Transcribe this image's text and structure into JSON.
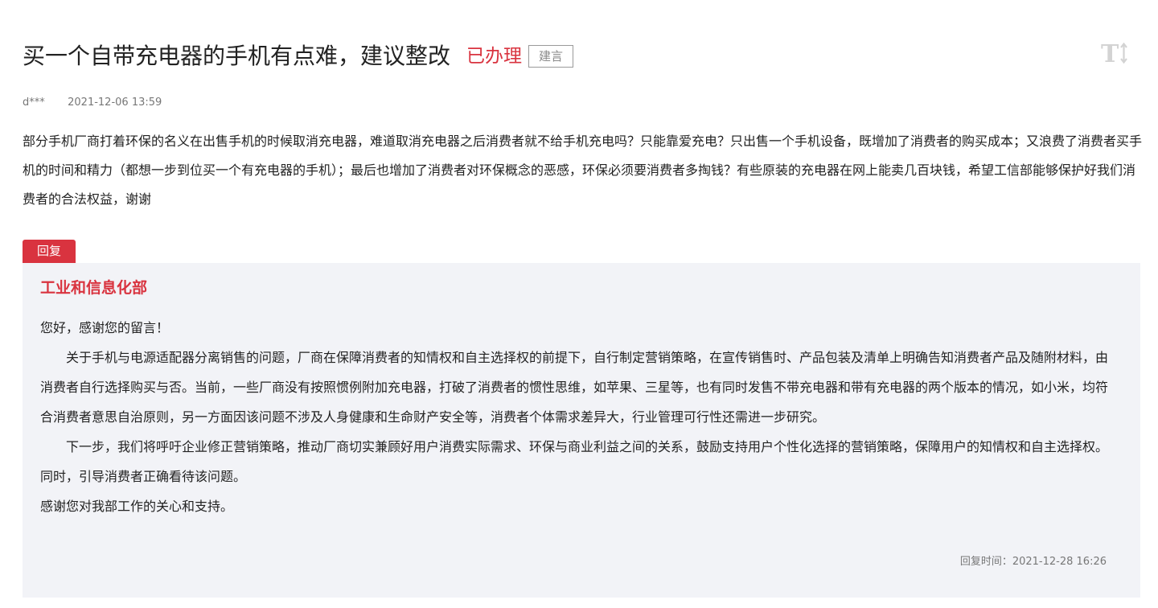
{
  "message": {
    "title": "买一个自带充电器的手机有点难，建议整改",
    "status": "已办理",
    "type": "建言",
    "author": "d***",
    "datetime": "2021-12-06 13:59",
    "content": "部分手机厂商打着环保的名义在出售手机的时候取消充电器，难道取消充电器之后消费者就不给手机充电吗？只能靠爱充电？只出售一个手机设备，既增加了消费者的购买成本；又浪费了消费者买手机的时间和精力（都想一步到位买一个有充电器的手机）；最后也增加了消费者对环保概念的恶感，环保必须要消费者多掏钱？有些原装的充电器在网上能卖几百块钱，希望工信部能够保护好我们消费者的合法权益，谢谢"
  },
  "toolbar": {
    "font_toggle_icon": "text-size-icon",
    "font_toggle_text": "T"
  },
  "reply": {
    "tab_label": "回复",
    "organization": "工业和信息化部",
    "paragraphs": [
      "您好，感谢您的留言！",
      "关于手机与电源适配器分离销售的问题，厂商在保障消费者的知情权和自主选择权的前提下，自行制定营销策略，在宣传销售时、产品包装及清单上明确告知消费者产品及随附材料，由消费者自行选择购买与否。当前，一些厂商没有按照惯例附加充电器，打破了消费者的惯性思维，如苹果、三星等，也有同时发售不带充电器和带有充电器的两个版本的情况，如小米，均符合消费者意思自治原则，另一方面因该问题不涉及人身健康和生命财产安全等，消费者个体需求差异大，行业管理可行性还需进一步研究。",
      "下一步，我们将呼吁企业修正营销策略，推动厂商切实兼顾好用户消费实际需求、环保与商业利益之间的关系，鼓励支持用户个性化选择的营销策略，保障用户的知情权和自主选择权。同时，引导消费者正确看待该问题。",
      "感谢您对我部工作的关心和支持。"
    ],
    "time_label": "回复时间：",
    "time_value": "2021-12-28 16:26"
  },
  "colors": {
    "accent": "#d9333f",
    "reply_background": "#f2f3f7",
    "muted_text": "#777777"
  }
}
